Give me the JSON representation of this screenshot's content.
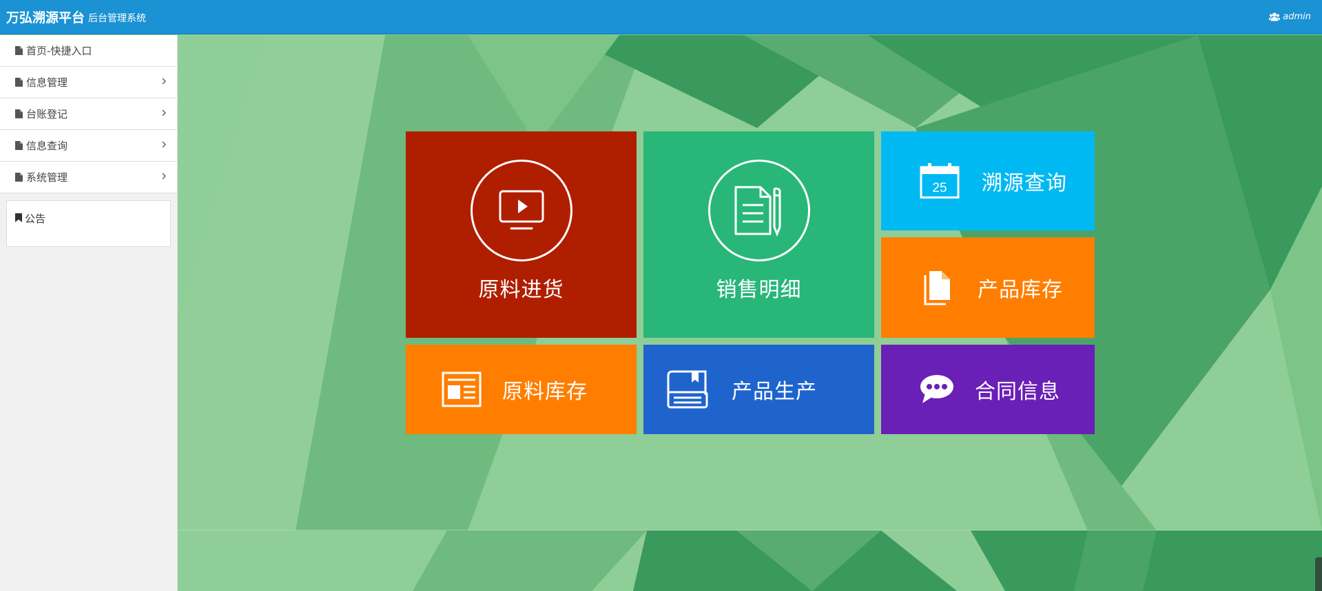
{
  "header": {
    "brand": "万弘溯源平台",
    "subtitle": "后台管理系统",
    "user": "admin",
    "user_icon": "users-icon",
    "bg_color": "#1a92d4"
  },
  "sidebar": {
    "items": [
      {
        "label": "首页-快捷入口",
        "icon": "file-icon",
        "has_submenu": false
      },
      {
        "label": "信息管理",
        "icon": "file-icon",
        "has_submenu": true
      },
      {
        "label": "台账登记",
        "icon": "file-icon",
        "has_submenu": true
      },
      {
        "label": "信息查询",
        "icon": "file-icon",
        "has_submenu": true
      },
      {
        "label": "系统管理",
        "icon": "file-icon",
        "has_submenu": true
      }
    ],
    "notice": {
      "label": "公告",
      "icon": "bookmark-icon"
    }
  },
  "tiles": [
    {
      "label": "原料进货",
      "icon": "monitor-play-icon",
      "color": "#b01e00"
    },
    {
      "label": "销售明细",
      "icon": "document-pencil-icon",
      "color": "#28b779"
    },
    {
      "label": "溯源查询",
      "icon": "calendar-icon",
      "color": "#00b9f2",
      "icon_text": "25"
    },
    {
      "label": "产品库存",
      "icon": "files-icon",
      "color": "#ff7e00"
    },
    {
      "label": "原料库存",
      "icon": "newspaper-icon",
      "color": "#ff7e00"
    },
    {
      "label": "产品生产",
      "icon": "inbox-icon",
      "color": "#1f64cd"
    },
    {
      "label": "合同信息",
      "icon": "chat-bubble-icon",
      "color": "#6a1fb6"
    }
  ]
}
